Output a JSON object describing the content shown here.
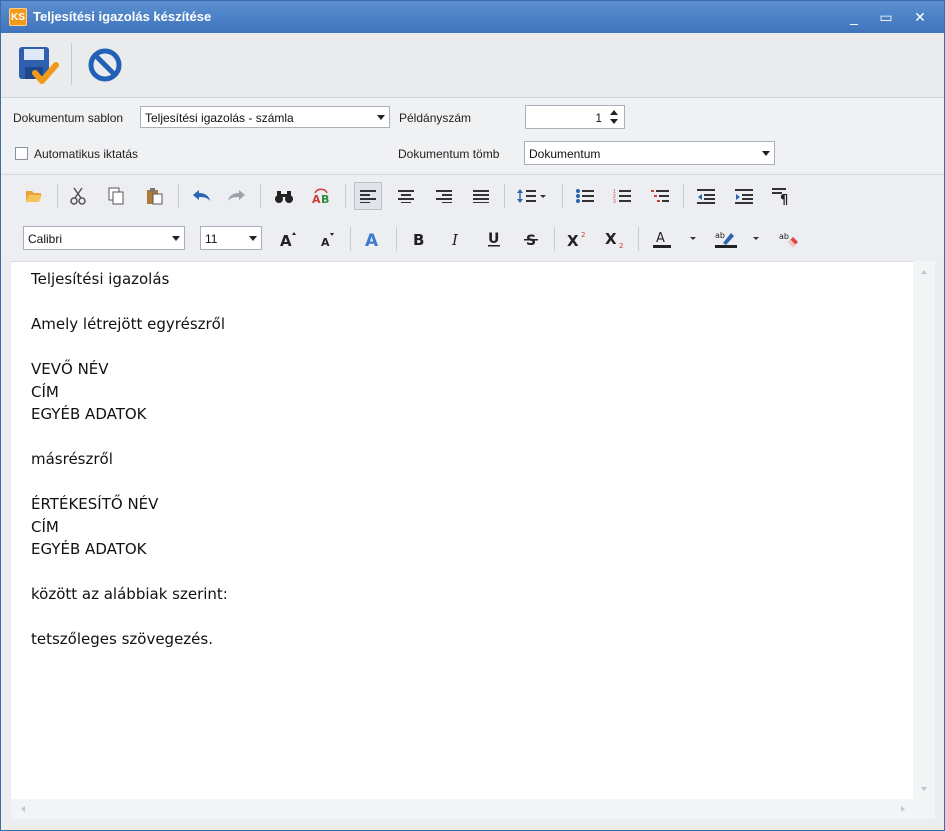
{
  "window": {
    "logo_text": "KS",
    "title": "Teljesítési igazolás készítése",
    "minimize_symbol": "_",
    "maximize_symbol": "▭",
    "close_symbol": "✕"
  },
  "main_toolbar": {
    "save_icon": "save-check-icon",
    "cancel_icon": "cancel-icon"
  },
  "form": {
    "template_label": "Dokumentum sablon",
    "template_value": "Teljesítési igazolás - számla",
    "copies_label": "Példányszám",
    "copies_value": "1",
    "auto_filing_label": "Automatikus iktatás",
    "auto_filing_checked": false,
    "doc_block_label": "Dokumentum tömb",
    "doc_block_value": "Dokumentum"
  },
  "editor_toolbar": {
    "font_name": "Calibri",
    "font_size": "11"
  },
  "document": {
    "lines": [
      "Teljesítési igazolás",
      "",
      "Amely létrejött egyrészről",
      "",
      "VEVŐ NÉV",
      "CÍM",
      "EGYÉB ADATOK",
      "",
      "másrészről",
      "",
      "ÉRTÉKESÍTŐ NÉV",
      "CÍM",
      "EGYÉB ADATOK",
      "",
      "között az alábbiak szerint:",
      "",
      "tetszőleges szövegezés."
    ]
  },
  "colors": {
    "titlebar": "#4a80c6",
    "accent_orange": "#f39a1a",
    "save_blue": "#2f5fae",
    "cancel_blue": "#2360b8"
  }
}
